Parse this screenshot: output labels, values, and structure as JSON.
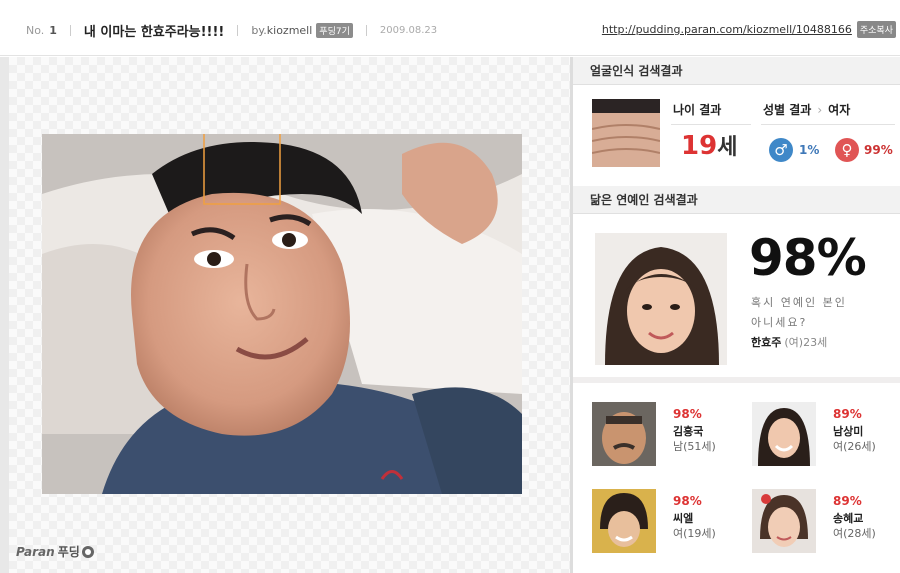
{
  "header": {
    "no_label": "No.",
    "no_value": "1",
    "title": "내 이마는 한효주라능!!!!",
    "by_label": "by.",
    "author": "kiozmell",
    "badge": "푸딩7기",
    "date": "2009.08.23",
    "url": "http://pudding.paran.com/kiozmell/10488166",
    "copy_label": "주소복사"
  },
  "footer": {
    "logo_text": "Paran",
    "logo_sub": "푸딩"
  },
  "face_result": {
    "section_title": "얼굴인식 검색결과",
    "age_label": "나이 결과",
    "age_value": "19",
    "age_unit": "세",
    "gender_label": "성별 결과",
    "gender_result": "여자",
    "male_pct": "1%",
    "female_pct": "99%",
    "colors": {
      "male": "#3f88c8",
      "female": "#e05555"
    }
  },
  "celeb_result": {
    "section_title": "닮은 연예인 검색결과",
    "top_pct": "98%",
    "question_line1": "혹시 연예인 본인",
    "question_line2": "아니세요?",
    "top_name": "한효주",
    "top_info": "(여)23세",
    "others": [
      {
        "pct": "98%",
        "name": "김흥국",
        "info": "남(51세)"
      },
      {
        "pct": "89%",
        "name": "남상미",
        "info": "여(26세)"
      },
      {
        "pct": "98%",
        "name": "씨엘",
        "info": "여(19세)"
      },
      {
        "pct": "89%",
        "name": "송혜교",
        "info": "여(28세)"
      }
    ]
  }
}
